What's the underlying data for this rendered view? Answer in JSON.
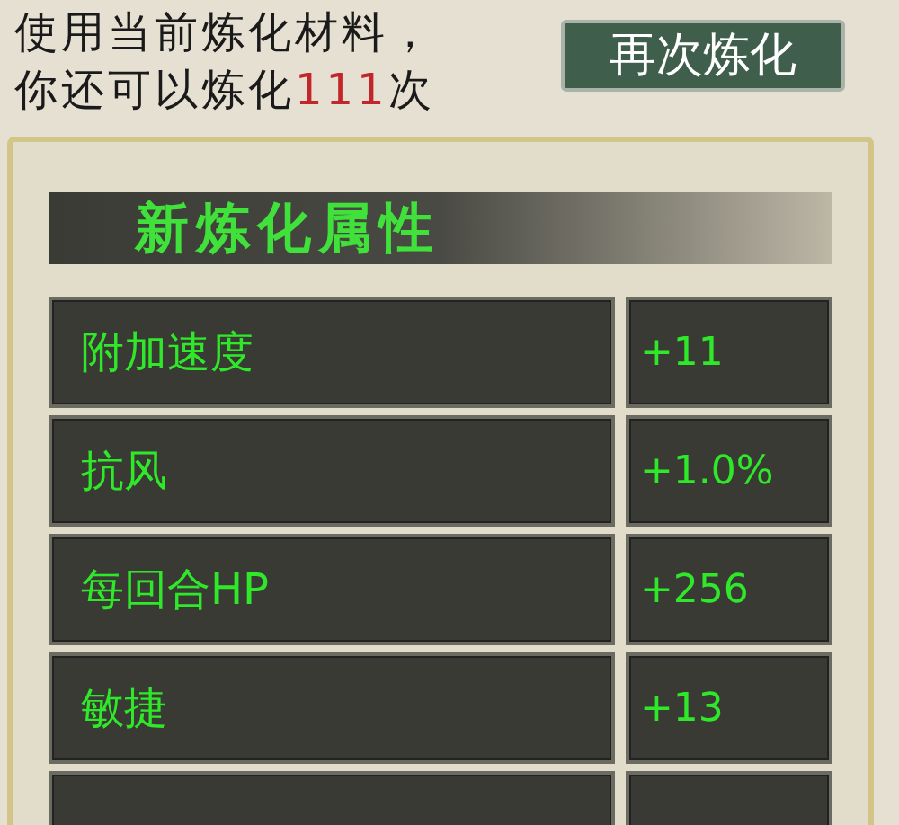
{
  "notice": {
    "line_1": "使用当前炼化材料，",
    "line_2_before": "你还可以炼化",
    "count": "111",
    "line_2_after": "次"
  },
  "refine_button": "再次炼化",
  "panel": {
    "title": "新炼化属性",
    "rows": [
      {
        "name": "附加速度",
        "value": "+11"
      },
      {
        "name": "抗风",
        "value": "+1.0%"
      },
      {
        "name": "每回合HP",
        "value": "+256"
      },
      {
        "name": "敏捷",
        "value": "+13"
      }
    ]
  }
}
